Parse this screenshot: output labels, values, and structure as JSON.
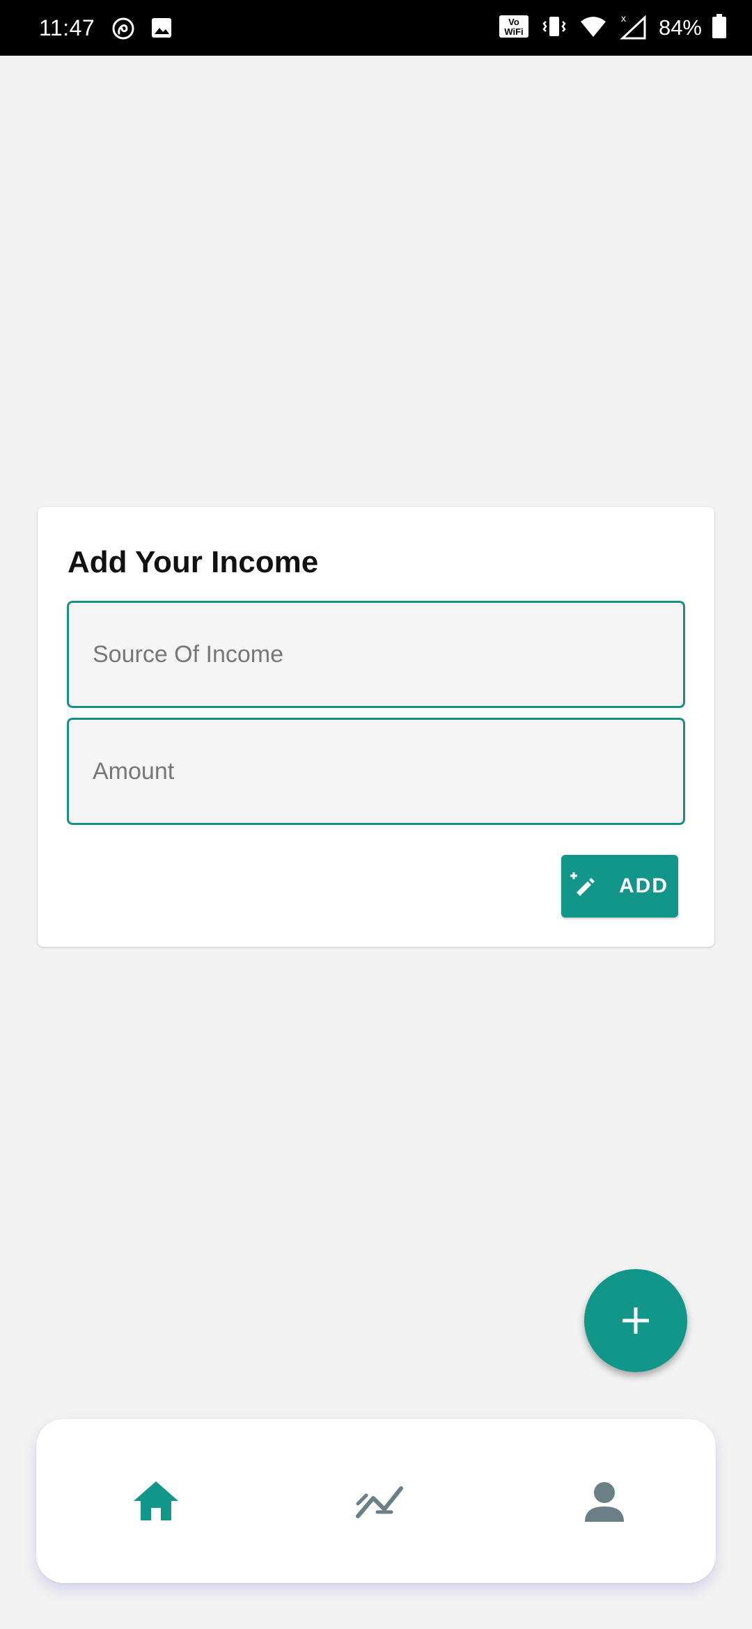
{
  "status_bar": {
    "time": "11:47",
    "battery": "84%",
    "icons": [
      "sync-icon",
      "image-icon",
      "vowifi-icon",
      "vibrate-icon",
      "wifi-icon",
      "signal-icon",
      "battery-icon"
    ]
  },
  "form": {
    "title": "Add Your Income",
    "source_placeholder": "Source Of Income",
    "source_value": "",
    "amount_placeholder": "Amount",
    "amount_value": "",
    "add_label": "ADD",
    "add_icon": "edit-icon"
  },
  "fab": {
    "icon": "plus-icon"
  },
  "bottom_nav": {
    "items": [
      {
        "icon": "home-icon",
        "active": true
      },
      {
        "icon": "trending-icon",
        "active": false
      },
      {
        "icon": "person-icon",
        "active": false
      }
    ]
  },
  "colors": {
    "accent": "#13968a",
    "field_border": "#1a8f86",
    "inactive_icon": "#6b8086",
    "background": "#f2f2f2"
  }
}
